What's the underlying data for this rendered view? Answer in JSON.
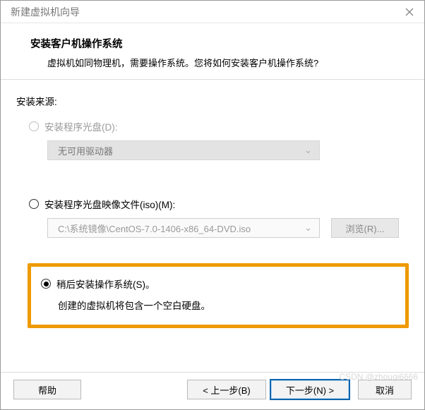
{
  "window": {
    "title": "新建虚拟机向导"
  },
  "header": {
    "title": "安装客户机操作系统",
    "subtitle": "虚拟机如同物理机，需要操作系统。您将如何安装客户机操作系统?"
  },
  "source": {
    "label": "安装来源:",
    "options": {
      "disc": {
        "label": "安装程序光盘(D):",
        "combo_value": "无可用驱动器",
        "enabled": false,
        "selected": false
      },
      "iso": {
        "label": "安装程序光盘映像文件(iso)(M):",
        "path_value": "C:\\系统镜像\\CentOS-7.0-1406-x86_64-DVD.iso",
        "browse_label": "浏览(R)...",
        "enabled": false,
        "selected": false
      },
      "later": {
        "label": "稍后安装操作系统(S)。",
        "note": "创建的虚拟机将包含一个空白硬盘。",
        "selected": true
      }
    }
  },
  "footer": {
    "help": "帮助",
    "back": "< 上一步(B)",
    "next": "下一步(N) >",
    "cancel": "取消"
  },
  "watermark": "CSDN @zhouqi6666"
}
